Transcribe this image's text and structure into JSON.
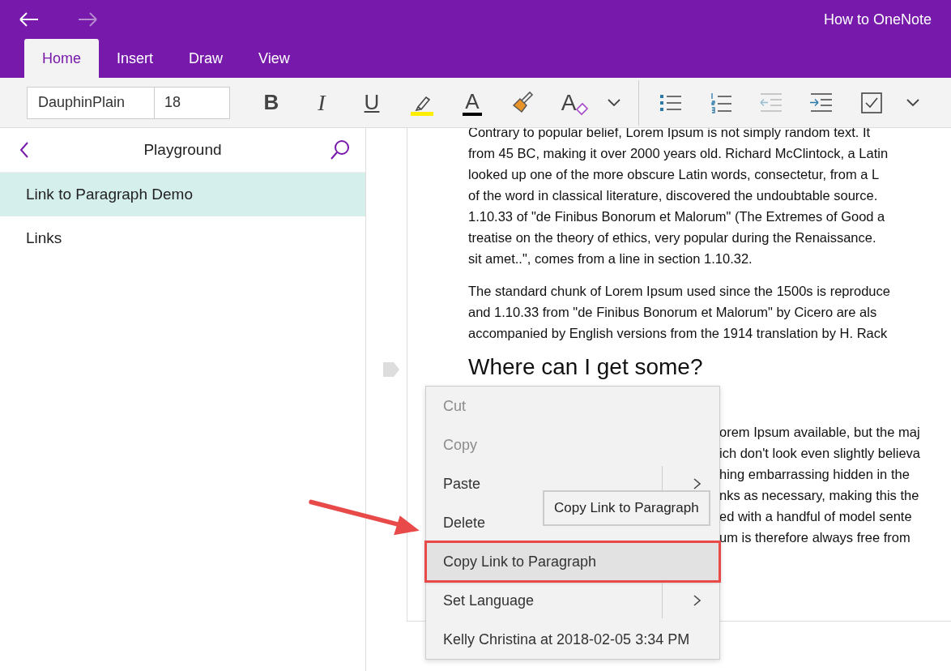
{
  "window": {
    "title": "How to OneNote",
    "back_enabled": true,
    "forward_enabled": false
  },
  "tabs": [
    {
      "label": "Home",
      "selected": true
    },
    {
      "label": "Insert",
      "selected": false
    },
    {
      "label": "Draw",
      "selected": false
    },
    {
      "label": "View",
      "selected": false
    }
  ],
  "toolbar": {
    "font_name": "DauphinPlain",
    "font_size": "18",
    "buttons": [
      {
        "kind": "bold",
        "label": "B"
      },
      {
        "kind": "italic",
        "label": "I"
      },
      {
        "kind": "underline",
        "label": "U"
      },
      {
        "kind": "highlight"
      },
      {
        "kind": "font_color",
        "label": "A"
      },
      {
        "kind": "painter"
      },
      {
        "kind": "clear",
        "label": "A"
      },
      {
        "kind": "more"
      },
      {
        "kind": "divider"
      },
      {
        "kind": "bullets"
      },
      {
        "kind": "numbering"
      },
      {
        "kind": "outdent",
        "disabled": true
      },
      {
        "kind": "indent"
      },
      {
        "kind": "todo"
      },
      {
        "kind": "more"
      }
    ]
  },
  "sidebar": {
    "title": "Playground",
    "pages": [
      {
        "label": "Link to Paragraph Demo",
        "selected": true
      },
      {
        "label": "Links",
        "selected": false
      }
    ]
  },
  "note": {
    "paragraphs": [
      [
        "Contrary to popular belief, Lorem Ipsum is not simply random text. It",
        "from 45 BC, making it over 2000 years old. Richard McClintock, a Latin",
        "looked up one of the more obscure Latin words, consectetur, from a L",
        "of the word in classical literature, discovered the undoubtable source.",
        "1.10.33 of \"de Finibus Bonorum et Malorum\" (The Extremes of Good a",
        "treatise on the theory of ethics, very popular during the Renaissance.",
        "sit amet..\", comes from a line in section 1.10.32."
      ],
      [
        "The standard chunk of Lorem Ipsum used since the 1500s is reproduce",
        "and 1.10.33 from \"de Finibus Bonorum et Malorum\" by Cicero are als",
        "accompanied by English versions from the 1914 translation by H. Rack"
      ]
    ],
    "heading": "Where can I get some?",
    "covered_lines": [
      "orem Ipsum available, but the maj",
      "ich don't look even slightly believa",
      "hing embarrassing hidden in the",
      "nks as necessary, making this the",
      "ed with a handful of model sente",
      "um is therefore always free from"
    ]
  },
  "context_menu": {
    "items": [
      {
        "label": "Cut",
        "disabled": true,
        "submenu": false,
        "highlighted": false
      },
      {
        "label": "Copy",
        "disabled": true,
        "submenu": false,
        "highlighted": false
      },
      {
        "label": "Paste",
        "disabled": false,
        "submenu": true,
        "highlighted": false
      },
      {
        "label": "Delete",
        "disabled": false,
        "submenu": false,
        "highlighted": false
      },
      {
        "label": "Copy Link to Paragraph",
        "disabled": false,
        "submenu": false,
        "highlighted": true
      },
      {
        "label": "Set Language",
        "disabled": false,
        "submenu": true,
        "highlighted": false
      },
      {
        "label": "Kelly Christina at 2018-02-05 3:34 PM",
        "disabled": false,
        "submenu": false,
        "highlighted": false
      }
    ],
    "tooltip": "Copy Link to Paragraph"
  }
}
